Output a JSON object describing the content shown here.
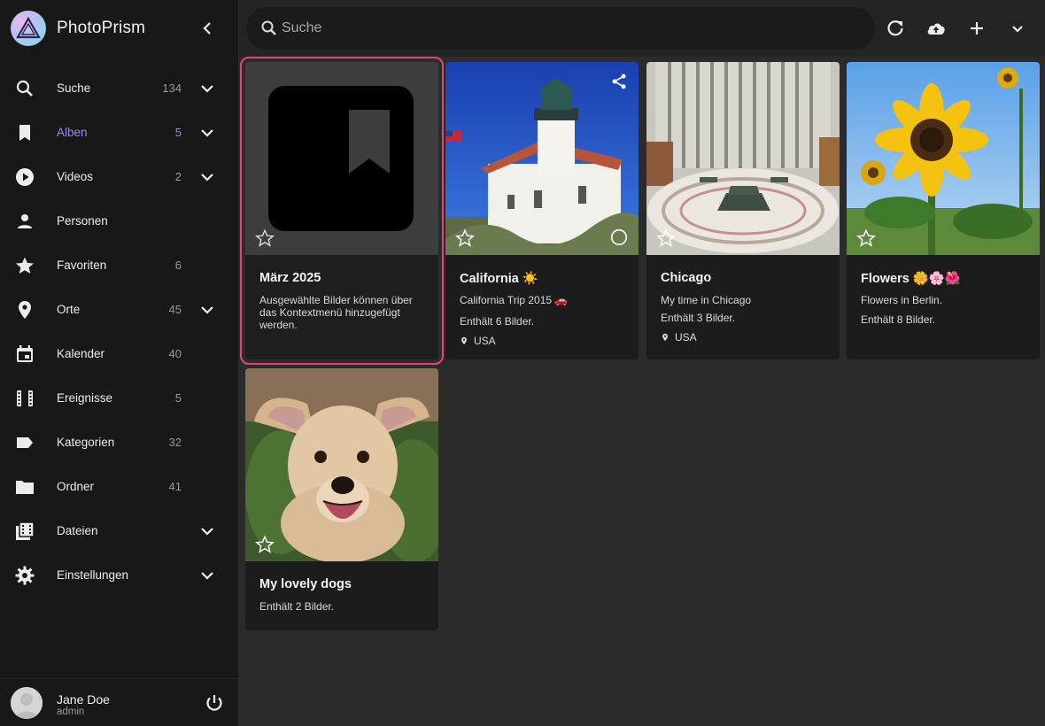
{
  "app": {
    "title": "PhotoPrism"
  },
  "sidebar": {
    "items": [
      {
        "label": "Suche",
        "count": "134",
        "icon": "search-icon"
      },
      {
        "label": "Alben",
        "count": "5",
        "icon": "bookmark-icon"
      },
      {
        "label": "Videos",
        "count": "2",
        "icon": "play-circle-icon"
      },
      {
        "label": "Personen",
        "count": "",
        "icon": "person-icon"
      },
      {
        "label": "Favoriten",
        "count": "6",
        "icon": "star-icon"
      },
      {
        "label": "Orte",
        "count": "45",
        "icon": "map-pin-icon"
      },
      {
        "label": "Kalender",
        "count": "40",
        "icon": "calendar-icon"
      },
      {
        "label": "Ereignisse",
        "count": "5",
        "icon": "film-icon"
      },
      {
        "label": "Kategorien",
        "count": "32",
        "icon": "label-icon"
      },
      {
        "label": "Ordner",
        "count": "41",
        "icon": "folder-icon"
      },
      {
        "label": "Dateien",
        "count": "",
        "icon": "files-icon"
      },
      {
        "label": "Einstellungen",
        "count": "",
        "icon": "gear-icon"
      }
    ],
    "active": "Alben",
    "accent_color": "#9c88ee"
  },
  "user": {
    "name": "Jane Doe",
    "role": "admin"
  },
  "search": {
    "placeholder": "Suche"
  },
  "albums": [
    {
      "title": "März 2025",
      "description": "Ausgewählte Bilder können über das Kontextmenü hinzugefügt werden.",
      "count_text": "",
      "location": ""
    },
    {
      "title": "California ☀️",
      "description": "California Trip 2015 🚗",
      "count_text": "Enthält 6 Bilder.",
      "location": "USA"
    },
    {
      "title": "Chicago",
      "description": "My time in Chicago",
      "count_text": "Enthält 3 Bilder.",
      "location": "USA"
    },
    {
      "title": "Flowers 🌼🌸🌺",
      "description": "Flowers in Berlin.",
      "count_text": "Enthält 8 Bilder.",
      "location": ""
    },
    {
      "title": "My lovely dogs",
      "description": "Enthält 2 Bilder.",
      "count_text": "",
      "location": ""
    }
  ],
  "selection_color": "#e0457b"
}
